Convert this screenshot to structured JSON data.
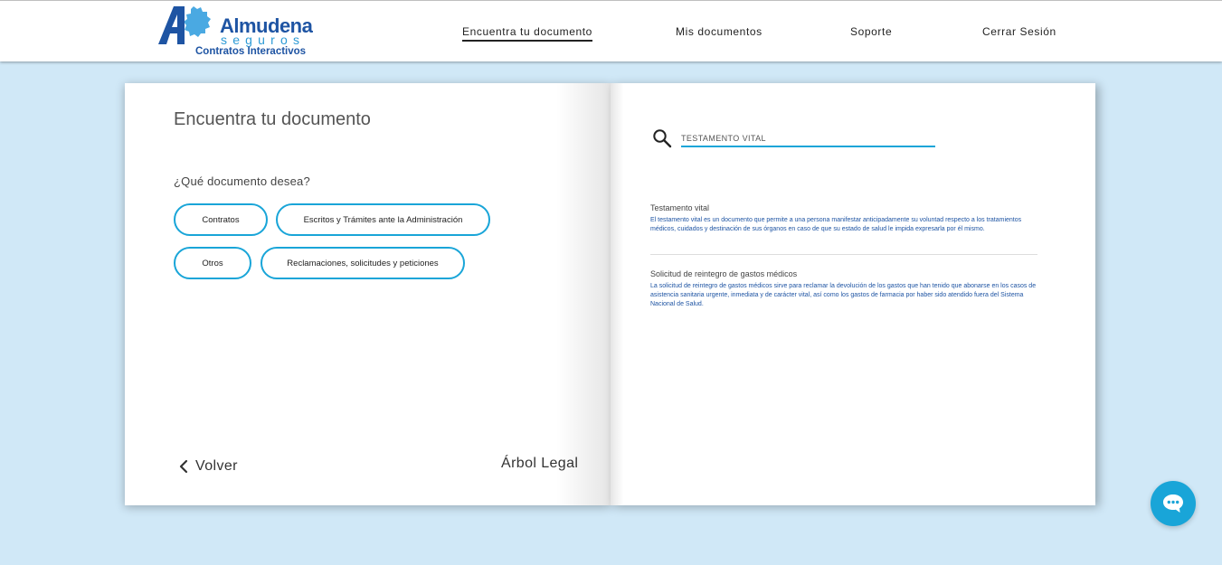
{
  "brand": {
    "name": "Almudena",
    "sub": "seguros",
    "tagline": "Contratos Interactivos",
    "primary_color": "#1e54a3",
    "accent_color": "#19a5d8"
  },
  "nav": {
    "items": [
      {
        "label": "Encuentra tu documento",
        "active": true
      },
      {
        "label": "Mis documentos"
      },
      {
        "label": "Soporte"
      },
      {
        "label": "Cerrar Sesión"
      }
    ]
  },
  "left": {
    "title": "Encuentra tu documento",
    "question": "¿Qué documento desea?",
    "categories": [
      {
        "label": "Contratos"
      },
      {
        "label": "Escritos y Trámites ante la Administración"
      },
      {
        "label": "Otros"
      },
      {
        "label": "Reclamaciones, solicitudes y peticiones"
      }
    ],
    "back_label": "Volver",
    "tree_label": "Árbol Legal"
  },
  "search": {
    "value": "TESTAMENTO VITAL",
    "icon": "search-icon"
  },
  "results": [
    {
      "title": "Testamento vital",
      "description": "El testamento vital es un documento que permite a una persona manifestar anticipadamente su voluntad respecto a los tratamientos médicos, cuidados y destinación de sus órganos en caso de que su estado de salud le impida expresarla por él mismo."
    },
    {
      "title": "Solicitud de reintegro de gastos médicos",
      "description": "La solicitud de reintegro de gastos médicos sirve para reclamar la devolución de los gastos que han tenido que abonarse en los casos de asistencia sanitaria urgente, inmediata y de carácter vital, así como los gastos de farmacia por haber sido atendido fuera del Sistema Nacional de Salud."
    }
  ],
  "chat": {
    "icon": "chat-bubble-icon"
  }
}
